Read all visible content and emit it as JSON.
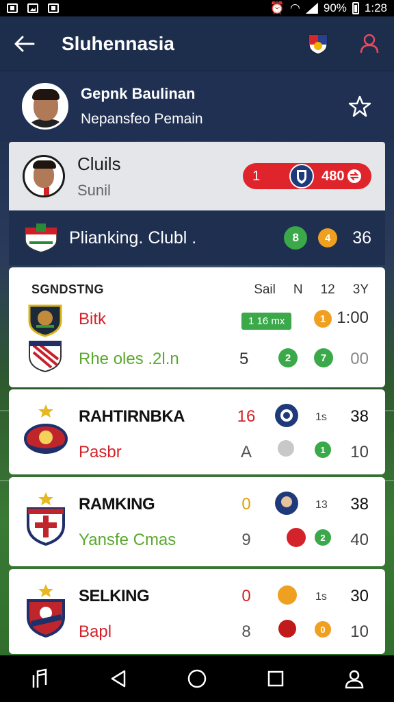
{
  "status_bar": {
    "battery": "90%",
    "time": "1:28"
  },
  "app_bar": {
    "title": "Sluhennasia"
  },
  "profile": {
    "name": "Gepnk Baulinan",
    "subtitle": "Nepansfeo Pemain"
  },
  "club_card": {
    "title": "Cluils",
    "subtitle": "Sunil",
    "score_left": "1",
    "score_right": "480"
  },
  "ranking_bar": {
    "label": "Plianking. Clubl .",
    "badge1": "8",
    "badge2": "4",
    "value": "36"
  },
  "standings": {
    "header": "SGNDSTNG",
    "columns": [
      "Sail",
      "N",
      "12",
      "3Y"
    ],
    "rows": [
      {
        "team": "Bitk",
        "pill": "1 16 mx",
        "badge": "1",
        "value": "1:00"
      },
      {
        "team": "Rhe oles .2l.n",
        "col1": "5",
        "badge1": "2",
        "badge2": "7",
        "value": "00"
      }
    ]
  },
  "teams": [
    {
      "name": "RAHTIRNBKA",
      "sub": "Pasbr",
      "a": "16",
      "b": "A",
      "small": "1s",
      "badge": "1",
      "n1": "38",
      "n2": "10"
    },
    {
      "name": "RAMKING",
      "sub": "Yansfe Cmas",
      "a": "0",
      "b": "9",
      "small": "13",
      "badge": "2",
      "n1": "38",
      "n2": "40"
    },
    {
      "name": "SELKING",
      "sub": "Bapl",
      "a": "0",
      "b": "8",
      "small": "1s",
      "badge": "0",
      "n1": "30",
      "n2": "10"
    }
  ],
  "colors": {
    "primary": "#1d2d4c",
    "accent_red": "#e0242c",
    "green": "#3ba84a",
    "orange": "#f0a020"
  },
  "icons": [
    "back-arrow-icon",
    "club-crest-icon",
    "profile-icon",
    "star-icon",
    "home-icon",
    "back-icon",
    "recent-apps-icon",
    "account-icon",
    "music-icon"
  ]
}
